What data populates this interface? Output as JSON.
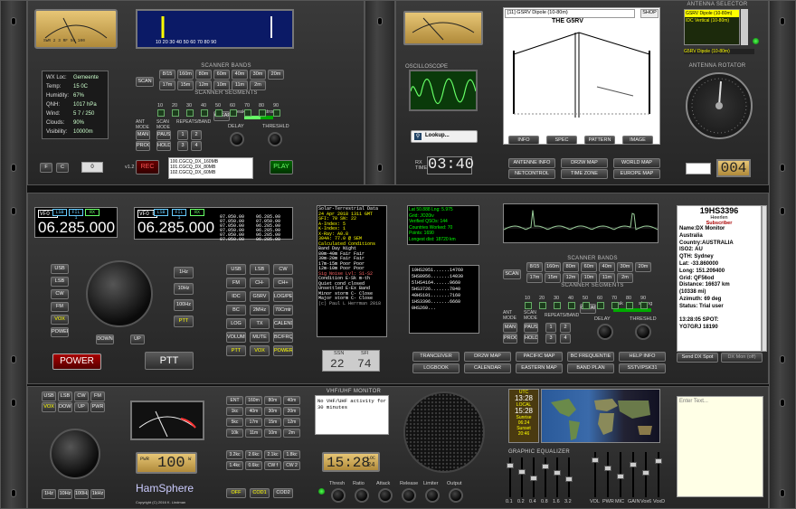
{
  "swr_meter": {
    "scale": "SWR 2 3 RF 50 100"
  },
  "scope_meter": {
    "scale": "10 20 30 40 50 60 70 80 90"
  },
  "scanner_bands": {
    "title": "SCANNER BANDS",
    "scan_label": "SCAN",
    "row1": [
      "8/15",
      "160m",
      "80m",
      "60m",
      "40m",
      "30m",
      "20m"
    ],
    "row2": [
      "17m",
      "15m",
      "12m",
      "10m",
      "11m",
      "2m"
    ],
    "segments_title": "SCANNER SEGMENTS",
    "segments": [
      "10",
      "20",
      "30",
      "40",
      "50",
      "60",
      "70",
      "80",
      "90"
    ],
    "clear": "CLEAR",
    "weak": "weak",
    "strong": "strong",
    "ant_mode": "ANT MODE",
    "scan_mode": "SCAN MODE",
    "repeats": "REPEATS/BAND",
    "man": "MAN",
    "pause": "PAUSE",
    "prog": "PROG",
    "hold": "HOLD",
    "delay": "DELAY",
    "threshold": "THRESHLD"
  },
  "weather": {
    "rows": [
      {
        "k": "WX Loc:",
        "v": "Gemeente"
      },
      {
        "k": "Temp:",
        "v": "15 0C"
      },
      {
        "k": "Humidity:",
        "v": "67%"
      },
      {
        "k": "QNH:",
        "v": "1017 hPa"
      },
      {
        "k": "Wind:",
        "v": "5 7 / 250"
      },
      {
        "k": "Clouds:",
        "v": "90%"
      },
      {
        "k": "Visibility:",
        "v": "10000m"
      }
    ]
  },
  "recorder": {
    "f_btn": "F",
    "c_btn": "C",
    "num": "0",
    "version": "v1.2",
    "rec": "REC",
    "play": "PLAY",
    "items": [
      "100.CGCQ_DX_160MB",
      "101.CGCQ_DX_80MB",
      "102.CGCQ_DX_60MB"
    ]
  },
  "antenna": {
    "selected": "[11] GSRV Dipole (10-80m)",
    "shop": "SHOP",
    "diagram_title": "THE G5RV",
    "tabs": [
      "INFO",
      "SPEC",
      "PATTERN",
      "IMAGE"
    ],
    "selector_title": "ANTENNA SELECTOR",
    "selector_items": [
      "GSRV Dipole (10-80m)",
      "IDC Vertical (10-80m)"
    ],
    "selector_current": "G5RV Dipole (10-80m)",
    "rotator_title": "ANTENNA ROTATOR",
    "rotator_value": "004"
  },
  "scope": {
    "title": "OSCILLOSCOPE",
    "lookup": "Lookup...",
    "rx_time_label": "RX TIME",
    "rx_time": "03:40"
  },
  "mid_buttons": [
    "ANTENNE INFO",
    "DR2W MAP",
    "WORLD MAP",
    "NETCONTROL",
    "TIME ZONE",
    "EUROPE MAP"
  ],
  "vfo": {
    "a_label": "VFO A",
    "b_label": "VFO B",
    "a_freq": "06.285.000",
    "b_freq": "06.285.000",
    "tags": [
      "LSB",
      "FIL 1",
      "RX"
    ],
    "mem_col1": [
      "07.050.00",
      "07.050.00",
      "07.050.00",
      "07.050.00",
      "07.050.00",
      "07.050.00"
    ],
    "mem_col2": [
      "06.285.00",
      "07.050.00",
      "06.285.00",
      "06.285.00",
      "06.285.00",
      "06.285.00"
    ]
  },
  "mode_buttons": [
    "USB",
    "LSB",
    "CW",
    "FM",
    "VOX",
    "POWER"
  ],
  "step_buttons": [
    "1Hz",
    "10Hz",
    "100Hz",
    "PTT"
  ],
  "down_up": [
    "DOWN",
    "UP"
  ],
  "func_grid": [
    [
      "USB",
      "LSB",
      "CW"
    ],
    [
      "FM",
      "CH-",
      "CH+"
    ],
    [
      "IDC",
      "G5RV",
      "LOG/PERD"
    ],
    [
      "BC",
      "2MHz",
      "70Cmtr"
    ],
    [
      "LOG",
      "TX",
      "CALEND"
    ],
    [
      "VOLUME",
      "MUTE",
      "BC/FRQ"
    ],
    [
      "PTT",
      "VOX",
      "POWER"
    ]
  ],
  "power_btn": "POWER",
  "ptt_btn": "PTT",
  "solar": {
    "title": "Solar-Terrestrial Data",
    "date": "24 Apr 2018 1311 GMT",
    "rows": [
      "SFI: 70  SN: 22",
      "A-Index: 5",
      "K-Index: 1",
      "X-Ray: A0.8",
      "304A: 77.0 @ SEM"
    ],
    "cond_title": "Calculated Conditions",
    "cond_head": "Band   Day  Night",
    "cond": [
      "80m-40m Fair Fair",
      "30m-20m Fair Fair",
      "17m-15m Poor Poor",
      "12m-10m Poor Poor"
    ],
    "sig": "Sig Noise Lvl: S1-S2",
    "vhf": [
      "Condition  E-Sk  m-th",
      "Quiet      cond  closed",
      "Unsettled  E-Ex  Band",
      "Minor storm  C-   Close",
      "Major storm  C-   Close"
    ],
    "footer": "(c) Paul L Herrman 2018"
  },
  "ssn": {
    "ssn_label": "SSN",
    "sfi_label": "SFI",
    "ssn": "22",
    "sfi": "74"
  },
  "stats": {
    "rows": [
      "Lat 50.888 Lng: 5.975",
      "Grid: JO20iv",
      "Verified QSOs: 144",
      "Countries Worked: 70",
      "Points: 1690",
      "Longest dist: 18720 km"
    ]
  },
  "dx_feed": [
    "19HS2951......14760",
    "5HS8956.......14030",
    "5lHS4164......9660",
    "5HS3726.......7840",
    "40HS101.......7160",
    "1HS3396.......6660",
    "0HS260..."
  ],
  "dx_monitor": {
    "call": "19HS3396",
    "place": "Heerlen",
    "sub": "Subscriber",
    "lines": [
      "Name:DX Monitor",
      "Australia",
      "Country:AUSTRALIA",
      "ISO2: AU",
      "QTH: Sydney",
      "Lat: -33.860000",
      "Long: 151.209400",
      "Grid: QF56od",
      "Distance: 16637 km",
      "(10338 mi)",
      "Azimuth: 69 deg",
      "Status: Trial user",
      "",
      "13:28:05 SPOT:",
      "YO7GRJ 18190"
    ],
    "send_btn": "Send DX Spot",
    "mon_btn": "DX Mon (off)"
  },
  "lower_buttons": [
    [
      "TRANCEIVER",
      "DR2W MAP",
      "PACIFIC MAP",
      "BC FREQUENTIE",
      "HELP INFO"
    ],
    [
      "LOGBOOK",
      "CALENDAR",
      "EASTERN MAP",
      "BAND PLAN",
      "SSTV/PSK31"
    ]
  ],
  "bottom_left": {
    "row1": [
      "USB",
      "LSB",
      "CW",
      "FM"
    ],
    "row2": [
      "VOX",
      "DOWN",
      "UP",
      "PWR"
    ],
    "steps": [
      "1Hz",
      "10Hz",
      "100Hz",
      "1kHz"
    ]
  },
  "pwr": {
    "label": "PWR",
    "value": "100",
    "unit": "W"
  },
  "hamsphere": {
    "logo": "HamSphere",
    "copy": "Copyright (C) 2016 K. Lindman"
  },
  "band_grid": [
    [
      "ENT",
      "160m",
      "80m",
      "40m"
    ],
    [
      "1kc",
      "40m",
      "30m",
      "20m"
    ],
    [
      "5kc",
      "17m",
      "15m",
      "12m"
    ],
    [
      "10k",
      "11m",
      "10m",
      "2m"
    ],
    [
      "",
      "",
      "",
      ""
    ],
    [
      "3.2kc",
      "2.6kc",
      "2.1kc",
      "1.8kc"
    ],
    [
      "1.4kc",
      "0.6kc",
      "CW f",
      "CW 2"
    ]
  ],
  "vhf": {
    "title": "VHF/UHF MONITOR",
    "text": "No VHF/UHF activity for 30 minutes"
  },
  "clock": {
    "time": "15:28",
    "loc_label": "LOC",
    "secs": "24"
  },
  "codecs": [
    "OFF",
    "COD1",
    "COD2"
  ],
  "dsp": [
    "Thresh",
    "Ratio",
    "Attack",
    "Release",
    "Limiter",
    "Output"
  ],
  "world": {
    "utc_label": "UTC",
    "utc": "13:28",
    "local_label": "LOCAL",
    "local": "15:28",
    "sunrise_label": "Sunrise",
    "sunrise": "06:24",
    "sunset_label": "Sunset",
    "sunset": "20:46"
  },
  "eq": {
    "title": "GRAPHIC EQUALIZER",
    "bands": [
      "0.1",
      "0.2",
      "0.4",
      "0.8",
      "1.6",
      "3.2"
    ],
    "mixer": [
      "VOL",
      "PWR",
      "MIC",
      "GAIN",
      "Vox6",
      "VoxD"
    ]
  },
  "notes": {
    "placeholder": "Enter Text..."
  }
}
